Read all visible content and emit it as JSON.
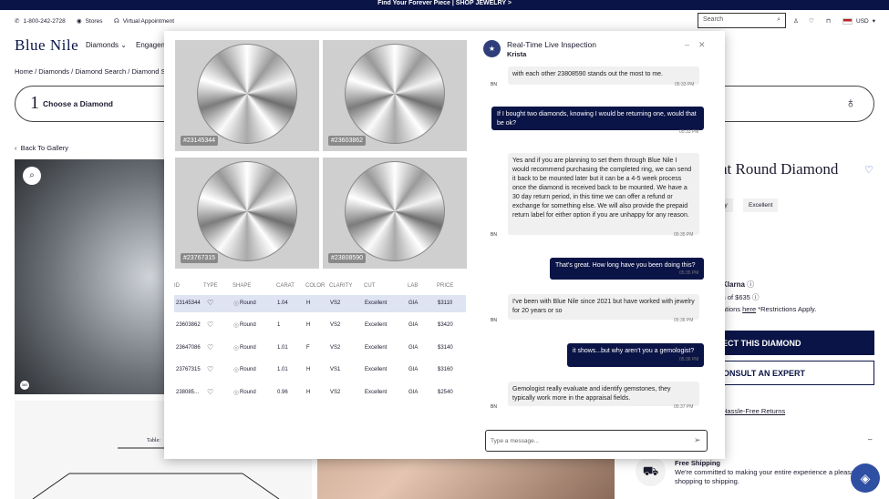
{
  "promo": "Find Your Forever Piece | SHOP JEWELRY >",
  "util": {
    "phone": "1-800-242-2728",
    "stores": "Stores",
    "appt": "Virtual Appointment",
    "currency": "USD"
  },
  "search": {
    "placeholder": "Search"
  },
  "logo": "Blue Nile",
  "nav": {
    "diamonds": "Diamonds",
    "engagement": "Engagem"
  },
  "breadcrumb": {
    "home": "Home",
    "diamonds": "Diamonds",
    "search": "Diamond Search",
    "store": "Diamond Stor"
  },
  "step": {
    "num": "1",
    "label": "Choose a Diamond"
  },
  "back": "Back To Gallery",
  "product": {
    "title": "at Round Diamond",
    "chip1": "larity",
    "chip2": "Excellent",
    "klarna": "Klarna",
    "line1": "s of $635",
    "line2_pre": "ations",
    "line2_link": "here",
    "line2_post": "*Restrictions Apply.",
    "select": "ECT THIS DIAMOND",
    "consult": "ONSULT AN EXPERT",
    "returns": "Hassle-Free Returns",
    "ship_title": "Free Shipping",
    "ship_desc": "We're committed to making your entire experience a pleasant from shopping to shipping."
  },
  "diagram": {
    "table": "Table:"
  },
  "tiles": [
    "#23145344",
    "#23603862",
    "#23767315",
    "#23808590"
  ],
  "table": {
    "headers": [
      "ID",
      "TYPE",
      "SHAPE",
      "CARAT",
      "COLOR",
      "CLARITY",
      "CUT",
      "LAB",
      "PRICE"
    ],
    "rows": [
      {
        "id": "23145344",
        "shape": "Round",
        "carat": "1.04",
        "color": "H",
        "clarity": "VS2",
        "cut": "Excellent",
        "lab": "GIA",
        "price": "$3110"
      },
      {
        "id": "23603862",
        "shape": "Round",
        "carat": "1",
        "color": "H",
        "clarity": "VS2",
        "cut": "Excellent",
        "lab": "GIA",
        "price": "$3420"
      },
      {
        "id": "23647086",
        "shape": "Round",
        "carat": "1.01",
        "color": "F",
        "clarity": "VS2",
        "cut": "Excellent",
        "lab": "GIA",
        "price": "$3140"
      },
      {
        "id": "23767315",
        "shape": "Round",
        "carat": "1.01",
        "color": "H",
        "clarity": "VS1",
        "cut": "Excellent",
        "lab": "GIA",
        "price": "$3160"
      },
      {
        "id": "238085...",
        "shape": "Round",
        "carat": "0.96",
        "color": "H",
        "clarity": "VS2",
        "cut": "Excellent",
        "lab": "GIA",
        "price": "$2540"
      }
    ]
  },
  "chat": {
    "title": "Real-Time Live Inspection",
    "agent": "Krista",
    "avatar": "BN",
    "messages": [
      {
        "from": "agent",
        "text": "with each other 23808590 stands out the most to me.",
        "time": "05:33 PM"
      },
      {
        "from": "user",
        "text": "If I bought two diamonds, knowing I would be returning one, would that be ok?",
        "time": "05:33 PM"
      },
      {
        "from": "agent",
        "text": "Yes and if you are planning to set them through Blue Nile I would recommend purchasing the completed ring, we can send it back to be mounted later but it can be a 4-5 week process once the diamond is received back to be mounted. We have a 30 day return period, in this time we can offer a refund or exchange for something else. We will also provide the prepaid return label for either option if you are unhappy for any reason.",
        "time": "05:35 PM"
      },
      {
        "from": "user",
        "text": "That's great. How long have you been doing this?",
        "time": "05:35 PM"
      },
      {
        "from": "agent",
        "text": "I've been with Blue Nile since 2021 but have worked with jewelry for 20 years or so",
        "time": "05:36 PM"
      },
      {
        "from": "user",
        "text": "it shows...but why aren't you a gemologist?",
        "time": "05:36 PM"
      },
      {
        "from": "agent",
        "text": "Gemologist really evaluate and identify gemstones, they typically work more in the appraisal fields.",
        "time": "05:37 PM"
      }
    ],
    "input_placeholder": "Type a message..."
  }
}
